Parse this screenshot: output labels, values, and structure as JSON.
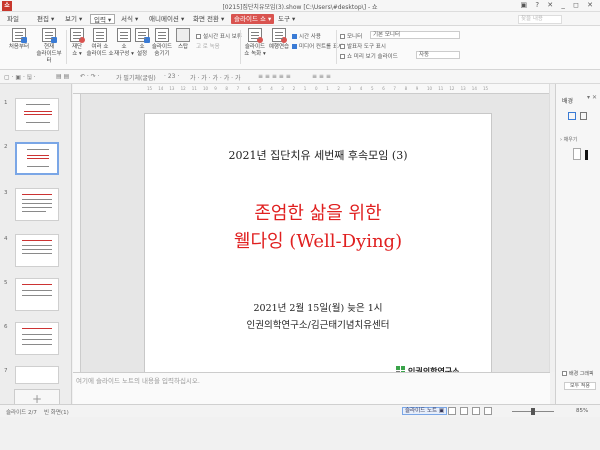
{
  "window": {
    "title": "[0215]집단치유모임(3).show [C:\\Users\\#desktop\\] - 쇼",
    "app_logo": "쇼",
    "controls": "▣ ? ✕  _ ◻ ✕"
  },
  "menubar": {
    "items": [
      {
        "label": "파일",
        "style": "plain"
      },
      {
        "label": "편집 ▾",
        "style": "plain"
      },
      {
        "label": "보기 ▾",
        "style": "plain"
      },
      {
        "label": "입력 ▾",
        "style": "boxed"
      },
      {
        "label": "서식 ▾",
        "style": "plain"
      },
      {
        "label": "애니메이션 ▾",
        "style": "plain"
      },
      {
        "label": "화면 전환 ▾",
        "style": "plain"
      },
      {
        "label": "슬라이드 쇼 ▾",
        "style": "red"
      },
      {
        "label": "도구 ▾",
        "style": "plain"
      }
    ],
    "help_placeholder": "찾을 내용"
  },
  "ribbon": {
    "buttons": [
      {
        "label": "처음부터",
        "icon": "slideshow-start-icon"
      },
      {
        "label": "현재\n슬라이드부터",
        "icon": "slideshow-current-icon"
      },
      {
        "label": "재단\n쇼 ▾",
        "icon": "rehearse-icon"
      },
      {
        "label": "여러 쇼\n슬라이드 쇼",
        "icon": "custom-show-icon"
      },
      {
        "label": "쇼\n재구성 ▾",
        "icon": "rebuild-show-icon"
      },
      {
        "label": "쇼\n설정",
        "icon": "show-settings-icon"
      },
      {
        "label": "슬라이드\n숨기기",
        "icon": "hide-slide-icon"
      },
      {
        "label": "스탑\n",
        "icon": "stop-icon"
      },
      {
        "label": "슬라이드\n쇼 녹화 ▾",
        "icon": "record-show-icon"
      },
      {
        "label": "예행연습",
        "icon": "rehearsal-icon"
      }
    ],
    "checks": [
      {
        "label": "설시간 표시 보류",
        "on": false
      },
      {
        "label": "시간 사용",
        "on": true
      },
      {
        "label": "미디어 컨트롤 표시",
        "on": true
      },
      {
        "label": "모니터",
        "on": false
      },
      {
        "label": "발표자 도구 표시",
        "on": false
      },
      {
        "label": "쇼 미리 보기 슬라이드",
        "on": false
      }
    ],
    "monitor_value": "기본 모니터",
    "preview_value": "자동",
    "narration_label": "고 로 녹음"
  },
  "formatbar": {
    "items": [
      "▢ · ▣ · 🖫 ·",
      "▤ ▤",
      "↶ · ↷ ·",
      "가 필기체(굴림)",
      "· 23 ·",
      "가 · 가 · 가 · 가 · 가",
      "≡ ≡ ≡ ≡ ≡",
      "≡ ≡ ≡"
    ]
  },
  "thumbnails": [
    {
      "num": "1",
      "selected": false
    },
    {
      "num": "2",
      "selected": true
    },
    {
      "num": "3",
      "selected": false
    },
    {
      "num": "4",
      "selected": false
    },
    {
      "num": "5",
      "selected": false
    },
    {
      "num": "6",
      "selected": false
    },
    {
      "num": "7",
      "selected": false
    }
  ],
  "add_slide_label": "+",
  "ruler": [
    "15",
    "14",
    "13",
    "12",
    "11",
    "10",
    "9",
    "8",
    "7",
    "6",
    "5",
    "4",
    "3",
    "2",
    "1",
    "0",
    "1",
    "2",
    "3",
    "4",
    "5",
    "6",
    "7",
    "8",
    "9",
    "10",
    "11",
    "12",
    "13",
    "14",
    "15"
  ],
  "slide": {
    "title": "2021년 집단치유 세번째 후속모임 (3)",
    "main_line1": "존엄한 삶을 위한",
    "main_line2": "웰다잉 (Well-Dying)",
    "date": "2021년 2월 15일(월) 늦은 1시",
    "org": "인권의학연구소/김근태기념치유센터",
    "logo_text": "인권의학연구소",
    "colors": {
      "main": "#e02020",
      "logo_green": "#3aa34a",
      "logo_gray": "#7b7b7b"
    }
  },
  "notes_placeholder": "여기에 슬라이드 노트의 내용을 입력하십시오.",
  "right_panel": {
    "title": "배경",
    "close": "▾ ✕",
    "sub": "› 채우기",
    "check_label": "배경 그래픽",
    "button_label": "모두 적용"
  },
  "status": {
    "slide_count": "슬라이드 2/7",
    "layout_name": "빈 화면(1)",
    "notes_toggle": "슬라이드 노트 ▣",
    "zoom": "85%",
    "zoom_fraction": 0.5
  }
}
